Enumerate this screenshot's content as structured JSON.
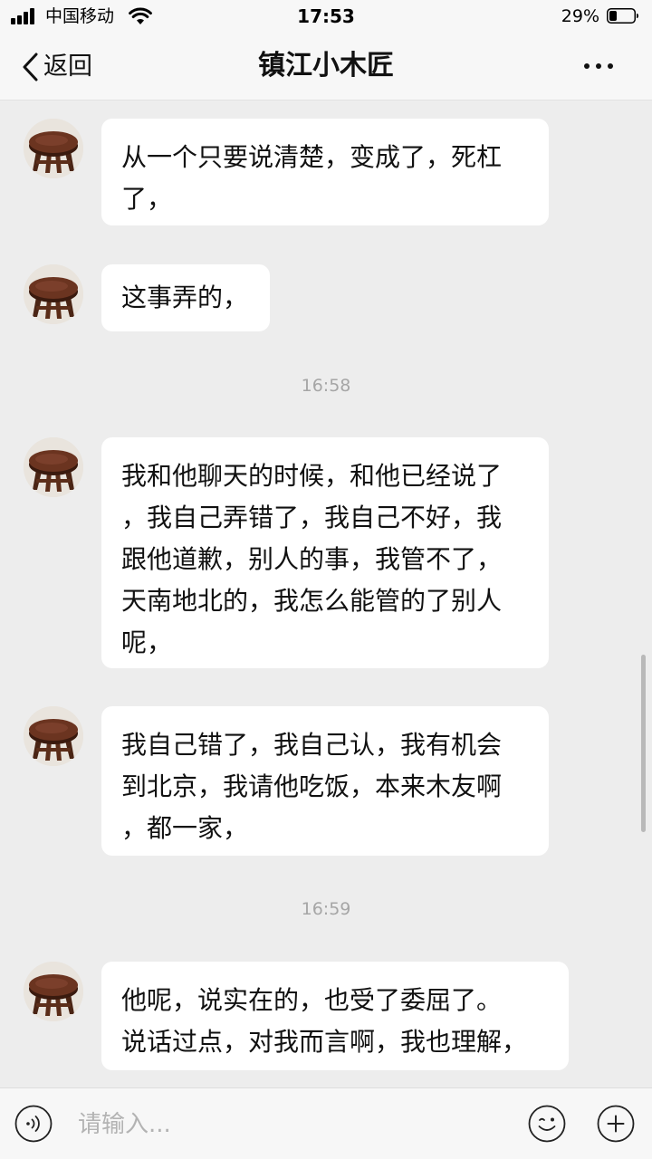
{
  "status_bar": {
    "carrier": "中国移动",
    "time": "17:53",
    "battery_percent": "29%",
    "battery_level": 0.29,
    "signal_bars": 4,
    "wifi_icon": "wifi-icon"
  },
  "nav": {
    "back_label": "返回",
    "title": "镇江小木匠",
    "back_icon": "chevron-left-icon",
    "more_icon": "more-dots-icon"
  },
  "messages": [
    {
      "type": "text",
      "sender": "镇江小木匠",
      "lines": [
        "从一个只要说清楚，变成了，死杠",
        "了，"
      ]
    },
    {
      "type": "text",
      "sender": "镇江小木匠",
      "lines": [
        "这事弄的，"
      ]
    },
    {
      "type": "time",
      "text": "16:58"
    },
    {
      "type": "text",
      "sender": "镇江小木匠",
      "lines": [
        "我和他聊天的时候，和他已经说了",
        "，我自己弄错了，我自己不好，我",
        "跟他道歉，别人的事，我管不了，",
        "天南地北的，我怎么能管的了别人",
        "呢，"
      ]
    },
    {
      "type": "text",
      "sender": "镇江小木匠",
      "lines": [
        "我自己错了，我自己认，我有机会",
        "到北京，我请他吃饭，本来木友啊",
        "，都一家，"
      ]
    },
    {
      "type": "time",
      "text": "16:59"
    },
    {
      "type": "text",
      "sender": "镇江小木匠",
      "lines": [
        "他呢，说实在的，也受了委屈了。",
        "说话过点，对我而言啊，我也理解，"
      ]
    }
  ],
  "input_bar": {
    "placeholder": "请输入...",
    "value": "",
    "voice_icon": "voice-icon",
    "emoji_icon": "emoji-icon",
    "add_icon": "plus-icon"
  },
  "colors": {
    "background": "#ededed",
    "bubble": "#ffffff",
    "bar": "#f7f7f7",
    "timestamp": "#a6a6a6"
  }
}
